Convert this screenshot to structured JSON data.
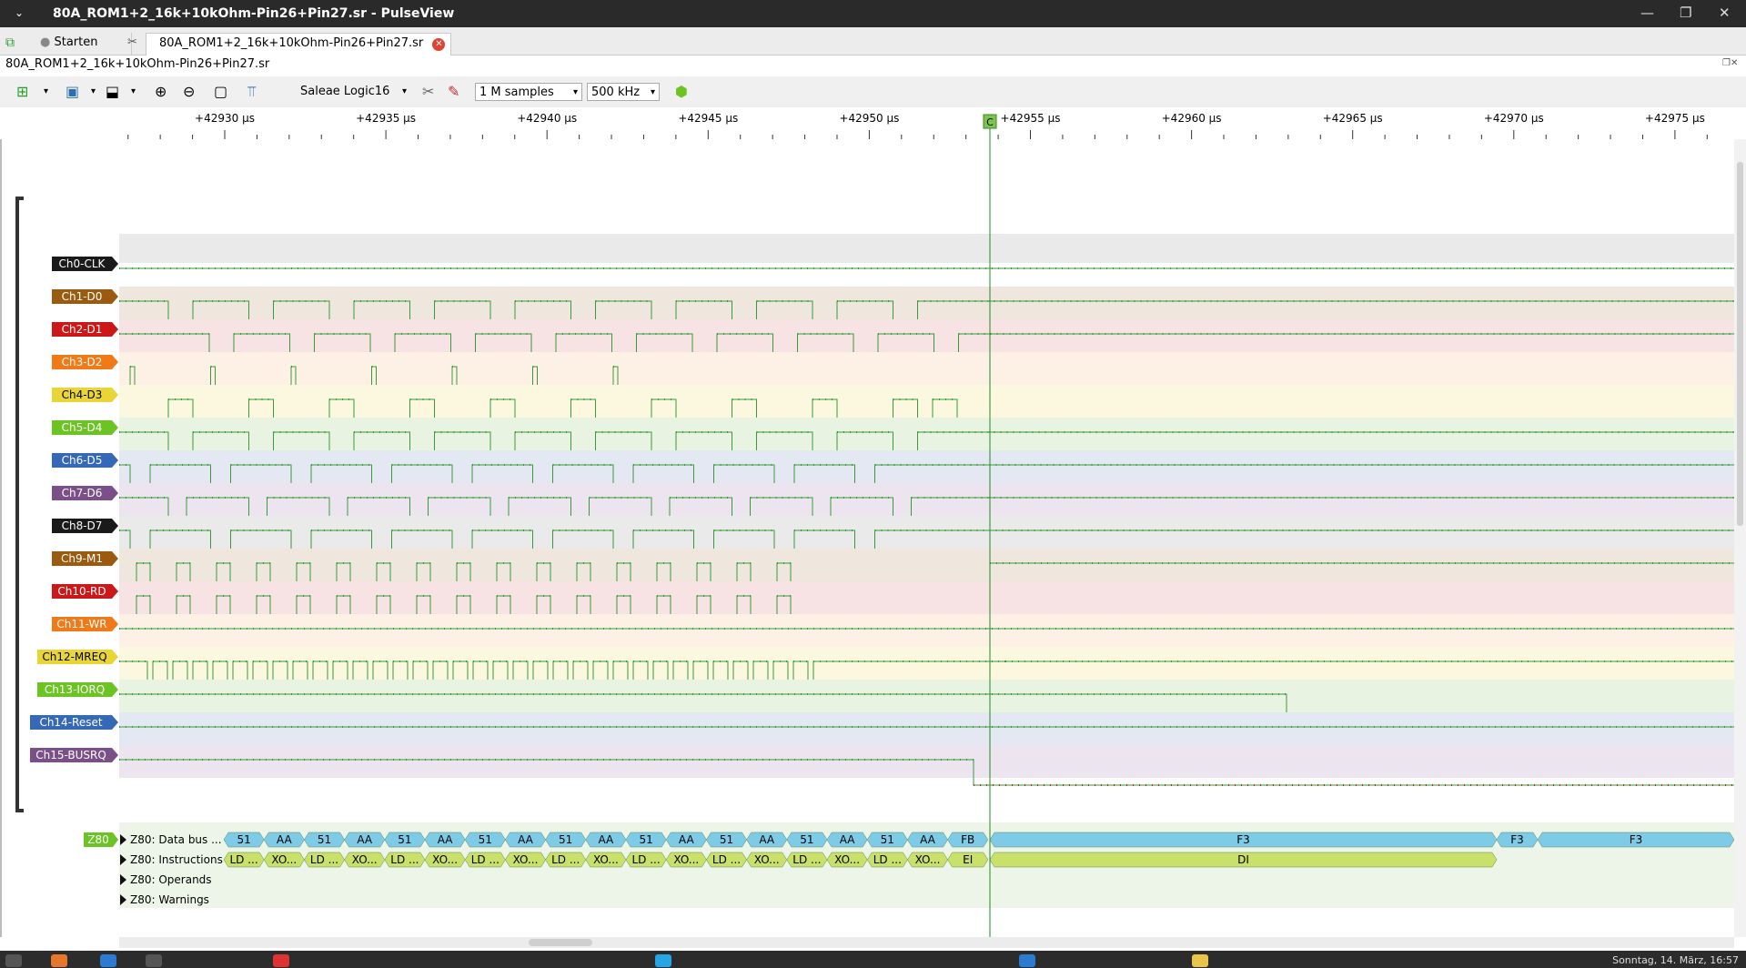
{
  "window": {
    "title": "80A_ROM1+2_16k+10kOhm-Pin26+Pin27.sr - PulseView",
    "menu_icon": "chevron-down-icon"
  },
  "tabs": [
    {
      "label": "Starten",
      "icon": "circle-icon"
    },
    {
      "label": "80A_ROM1+2_16k+10kOhm-Pin26+Pin27.sr",
      "icon": "close-icon"
    }
  ],
  "session_title": "80A_ROM1+2_16k+10kOhm-Pin26+Pin27.sr",
  "toolbar": {
    "device": "Saleae Logic16",
    "samples": "1 M samples",
    "rate": "500 kHz"
  },
  "ruler": {
    "ticks": [
      "+42930 µs",
      "+42935 µs",
      "+42940 µs",
      "+42945 µs",
      "+42950 µs",
      "+42955 µs",
      "+42960 µs",
      "+42965 µs",
      "+42970 µs",
      "+42975 µs"
    ],
    "cursor_flag": "C"
  },
  "signals": [
    {
      "name": "Ch0-CLK",
      "color": "#1a1a1a",
      "bg": "#eaeaea",
      "trans": []
    },
    {
      "name": "Ch1-D0",
      "color": "#9a5a10",
      "bg": "#efe7dd",
      "trans": [
        0.2,
        0.2,
        0.2,
        0.2,
        0.2,
        0.2,
        0.2,
        0.2,
        0.2,
        0.2,
        0.2,
        0.2,
        0.2,
        0.2,
        0.2,
        0.2,
        0.2,
        0.2,
        0.2,
        0.2,
        0.2,
        0.2,
        0.2,
        0.2
      ]
    },
    {
      "name": "Ch2-D1",
      "color": "#cc1818",
      "bg": "#f7e3e3",
      "trans": [
        0.2,
        0.2,
        0.2,
        0.2,
        0.2,
        0.2,
        0.2,
        0.2,
        0.2,
        0.2,
        0.2,
        0.2,
        0.2,
        0.2,
        0.2,
        0.2,
        0.2,
        0.2,
        0.2,
        0.2,
        0.2,
        0.2
      ]
    },
    {
      "name": "Ch3-D2",
      "color": "#ef7a17",
      "bg": "#fdf0e4",
      "trans": []
    },
    {
      "name": "Ch4-D3",
      "color": "#e9d636",
      "bg": "#fbf8df",
      "trans": []
    },
    {
      "name": "Ch5-D4",
      "color": "#6cc324",
      "bg": "#e9f3e2",
      "trans": []
    },
    {
      "name": "Ch6-D5",
      "color": "#3568b6",
      "bg": "#e4e8f2",
      "trans": []
    },
    {
      "name": "Ch7-D6",
      "color": "#7b4f88",
      "bg": "#ece5ef",
      "trans": []
    },
    {
      "name": "Ch8-D7",
      "color": "#1a1a1a",
      "bg": "#eaeaea",
      "trans": []
    },
    {
      "name": "Ch9-M1",
      "color": "#9a5a10",
      "bg": "#efe7dd",
      "trans": []
    },
    {
      "name": "Ch10-RD",
      "color": "#cc1818",
      "bg": "#f7e3e3",
      "trans": []
    },
    {
      "name": "Ch11-WR",
      "color": "#ef7a17",
      "bg": "#fdf0e4",
      "trans": []
    },
    {
      "name": "Ch12-MREQ",
      "color": "#e9d636",
      "bg": "#fbf8df",
      "trans": []
    },
    {
      "name": "Ch13-IORQ",
      "color": "#6cc324",
      "bg": "#e9f3e2",
      "trans": []
    },
    {
      "name": "Ch14-Reset",
      "color": "#3568b6",
      "bg": "#e4e8f2",
      "trans": []
    },
    {
      "name": "Ch15-BUSRQ",
      "color": "#7b4f88",
      "bg": "#ece5ef",
      "trans": []
    }
  ],
  "decoder": {
    "name": "Z80",
    "rows": [
      {
        "label": "Z80: Data bus ...",
        "items": [
          "51",
          "AA",
          "51",
          "AA",
          "51",
          "AA",
          "51",
          "AA",
          "51",
          "AA",
          "51",
          "AA",
          "51",
          "AA",
          "51",
          "AA",
          "51",
          "AA",
          "FB",
          "F3",
          "F3",
          "F3"
        ]
      },
      {
        "label": "Z80: Instructions",
        "items": [
          "LD ...",
          "XO...",
          "LD ...",
          "XO...",
          "LD ...",
          "XO...",
          "LD ...",
          "XO...",
          "LD ...",
          "XO...",
          "LD ...",
          "XO...",
          "LD ...",
          "XO...",
          "LD ...",
          "XO...",
          "LD ...",
          "XO...",
          "EI",
          "DI"
        ]
      },
      {
        "label": "Z80: Operands",
        "items": []
      },
      {
        "label": "Z80: Warnings",
        "items": []
      }
    ]
  },
  "colors": {
    "high_dot": "#2fa02f",
    "low_dot": "#c02020",
    "cursor": "#1e8a1e",
    "decoder_blue": "#7ecbe8",
    "decoder_green": "#c9e06a"
  },
  "taskbar": {
    "clock": "Sonntag, 14. März, 16:57"
  }
}
